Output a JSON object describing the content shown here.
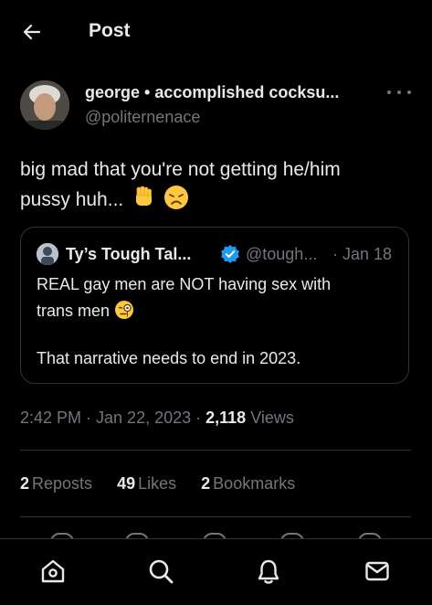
{
  "header": {
    "title": "Post",
    "back_icon": "arrow-left-icon"
  },
  "post": {
    "author_name": "george • accomplished cocksu...",
    "author_handle": "@politernenace",
    "text_line1": "big mad that you're not getting he/him",
    "text_line2": "pussy huh...",
    "emojis": [
      "raised-fist-emoji",
      "disappointed-face-emoji"
    ],
    "timestamp": "2:42 PM · Jan 22, 2023 · ",
    "views_count": "2,118",
    "views_label": " Views"
  },
  "quote": {
    "name": "Ty’s Tough Tal...",
    "handle": "@tough...",
    "date": "· Jan 18",
    "line1": "REAL gay men are NOT having sex with",
    "line2": "trans men",
    "line3": "That narrative needs to end in 2023.",
    "emoji": "face-with-monocle-emoji"
  },
  "stats": {
    "reposts_count": "2",
    "reposts_label": "Reposts",
    "likes_count": "49",
    "likes_label": "Likes",
    "bookmarks_count": "2",
    "bookmarks_label": "Bookmarks"
  },
  "nav": [
    "home-icon",
    "search-icon",
    "notifications-icon",
    "messages-icon"
  ],
  "colors": {
    "background": "#000000",
    "text": "#e7e9ea",
    "secondary": "#71767b",
    "border": "#2f3336",
    "verified": "#1d9bf0"
  }
}
